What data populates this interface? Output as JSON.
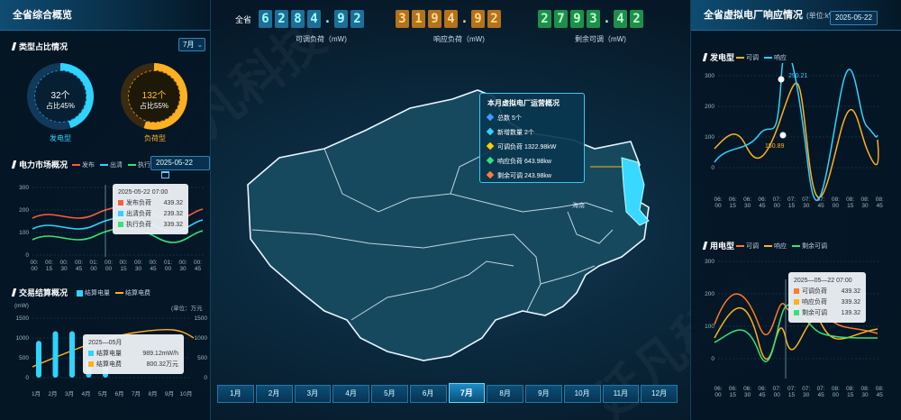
{
  "colors": {
    "accent": "#2fd3ff",
    "orange": "#ffb020",
    "green": "#36e27a",
    "red": "#ff5a3c"
  },
  "left": {
    "title": "全省综合概览",
    "type_section": {
      "title": "类型占比情况",
      "month": "7月",
      "gen": {
        "count": "32个",
        "ratio": "占比45%",
        "label": "发电型",
        "fraction": 0.45
      },
      "load": {
        "count": "132个",
        "ratio": "占比55%",
        "label": "负荷型",
        "fraction": 0.55
      }
    },
    "market": {
      "title": "电力市场概况",
      "legend": [
        "发布",
        "出清",
        "执行"
      ],
      "date": "2025-05-22",
      "yticks": [
        "300",
        "200",
        "100",
        "0"
      ],
      "xticks": [
        "00:\n00",
        "00:\n15",
        "00:\n30",
        "00:\n45",
        "01:\n00",
        "00:\n00",
        "00:\n15",
        "00:\n30",
        "00:\n45",
        "01:\n00",
        "00:\n30",
        "00:\n45"
      ],
      "tooltip": {
        "time": "2025-05-22 07:00",
        "rows": [
          {
            "name": "发布负荷",
            "value": "439.32"
          },
          {
            "name": "出清负荷",
            "value": "239.32"
          },
          {
            "name": "执行负荷",
            "value": "339.32"
          }
        ]
      }
    },
    "trade": {
      "title": "交易结算概况",
      "legend": [
        "结算电量",
        "结算电费"
      ],
      "unit_left": "(mW)",
      "unit_right": "(单位：万元",
      "yticks_left": [
        "1500",
        "1000",
        "500",
        "0"
      ],
      "yticks_right": [
        "1500",
        "1000",
        "500",
        "0"
      ],
      "months": [
        "1月",
        "2月",
        "3月",
        "4月",
        "5月",
        "6月",
        "7月",
        "8月",
        "9月",
        "10月"
      ],
      "tooltip": {
        "title": "2025—05月",
        "rows": [
          {
            "name": "结算电量",
            "value": "989.12mW/h"
          },
          {
            "name": "结算电费",
            "value": "800.32万元"
          }
        ]
      }
    }
  },
  "top": {
    "prefix": "全省",
    "kpis": [
      {
        "digits": [
          "6",
          "2",
          "8",
          "4",
          ".",
          "9",
          "2"
        ],
        "label": "可调负荷（mW)"
      },
      {
        "digits": [
          "3",
          "1",
          "9",
          "4",
          ".",
          "9",
          "2"
        ],
        "label": "响应负荷（mW)"
      },
      {
        "digits": [
          "2",
          "7",
          "9",
          "3",
          ".",
          "4",
          "2"
        ],
        "label": "剩余可调（mW)"
      }
    ]
  },
  "map": {
    "region_label": "海南",
    "overview": {
      "title": "本月虚拟电厂运营概况",
      "rows": [
        {
          "text": "总数  5个",
          "color": "#3aa0ff"
        },
        {
          "text": "新增数量  2个",
          "color": "#2fd3ff"
        },
        {
          "text": "可调负荷  1322.98kW",
          "color": "#ffd000"
        },
        {
          "text": "响应负荷  643.98kw",
          "color": "#36e27a"
        },
        {
          "text": "剩余可调  243.98kw",
          "color": "#ff7a45"
        }
      ]
    }
  },
  "months": [
    "1月",
    "2月",
    "3月",
    "4月",
    "5月",
    "6月",
    "7月",
    "8月",
    "9月",
    "10月",
    "11月",
    "12月"
  ],
  "selected_month": "7月",
  "right": {
    "title": "全省虚拟电厂响应情况",
    "unit": "(单位:kW)",
    "date": "2025-05-22",
    "gen": {
      "title": "发电型",
      "legend": [
        "可调",
        "响应"
      ],
      "yticks": [
        "300",
        "200",
        "100",
        "0"
      ],
      "peak": "290.21",
      "low": "150.89"
    },
    "use": {
      "title": "用电型",
      "legend": [
        "可调",
        "响应",
        "剩余可调"
      ],
      "yticks": [
        "300",
        "200",
        "100",
        "0"
      ],
      "tooltip": {
        "time": "2025—05—22 07:00",
        "rows": [
          {
            "name": "可调负荷",
            "value": "439.32"
          },
          {
            "name": "响应负荷",
            "value": "339.32"
          },
          {
            "name": "剩余可调",
            "value": "139.32"
          }
        ]
      }
    },
    "xticks": [
      "06:\n00",
      "06:\n15",
      "06:\n30",
      "06:\n45",
      "07:\n00",
      "07:\n15",
      "07:\n30",
      "07:\n45",
      "08:\n00",
      "08:\n15",
      "08:\n30",
      "08:\n45"
    ]
  },
  "watermark": "延凡科技"
}
